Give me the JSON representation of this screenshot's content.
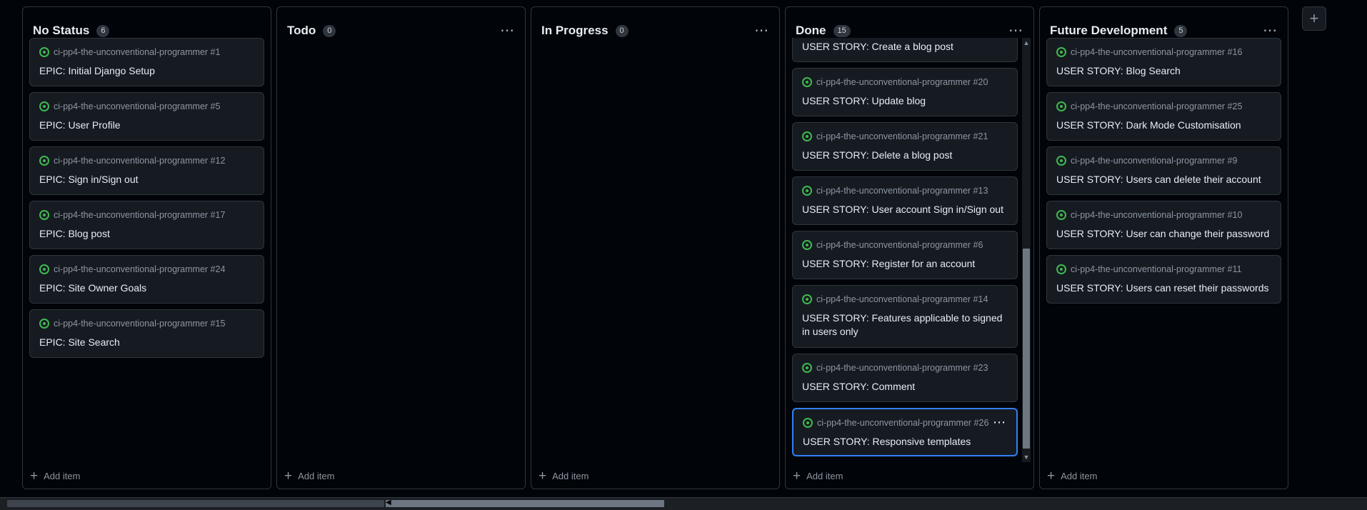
{
  "columns": [
    {
      "title": "No Status",
      "count": "6",
      "cards": [
        {
          "meta": "ci-pp4-the-unconventional-programmer #1",
          "title": "EPIC: Initial Django Setup"
        },
        {
          "meta": "ci-pp4-the-unconventional-programmer #5",
          "title": "EPIC: User Profile"
        },
        {
          "meta": "ci-pp4-the-unconventional-programmer #12",
          "title": "EPIC: Sign in/Sign out"
        },
        {
          "meta": "ci-pp4-the-unconventional-programmer #17",
          "title": "EPIC: Blog post"
        },
        {
          "meta": "ci-pp4-the-unconventional-programmer #24",
          "title": "EPIC: Site Owner Goals"
        },
        {
          "meta": "ci-pp4-the-unconventional-programmer #15",
          "title": "EPIC: Site Search"
        }
      ],
      "add_label": "Add item"
    },
    {
      "title": "Todo",
      "count": "0",
      "cards": [],
      "add_label": "Add item"
    },
    {
      "title": "In Progress",
      "count": "0",
      "cards": [],
      "add_label": "Add item"
    },
    {
      "title": "Done",
      "count": "15",
      "cards": [
        {
          "meta": "",
          "title": "USER STORY: Create a blog post"
        },
        {
          "meta": "ci-pp4-the-unconventional-programmer #20",
          "title": "USER STORY: Update blog"
        },
        {
          "meta": "ci-pp4-the-unconventional-programmer #21",
          "title": "USER STORY: Delete a blog post"
        },
        {
          "meta": "ci-pp4-the-unconventional-programmer #13",
          "title": "USER STORY: User account Sign in/Sign out"
        },
        {
          "meta": "ci-pp4-the-unconventional-programmer #6",
          "title": "USER STORY: Register for an account"
        },
        {
          "meta": "ci-pp4-the-unconventional-programmer #14",
          "title": "USER STORY: Features applicable to signed in users only"
        },
        {
          "meta": "ci-pp4-the-unconventional-programmer #23",
          "title": "USER STORY: Comment"
        },
        {
          "meta": "ci-pp4-the-unconventional-programmer #26",
          "title": "USER STORY: Responsive templates"
        }
      ],
      "add_label": "Add item"
    },
    {
      "title": "Future Development",
      "count": "5",
      "cards": [
        {
          "meta": "ci-pp4-the-unconventional-programmer #16",
          "title": "USER STORY: Blog Search"
        },
        {
          "meta": "ci-pp4-the-unconventional-programmer #25",
          "title": "USER STORY: Dark Mode Customisation"
        },
        {
          "meta": "ci-pp4-the-unconventional-programmer #9",
          "title": "USER STORY: Users can delete their account"
        },
        {
          "meta": "ci-pp4-the-unconventional-programmer #10",
          "title": "USER STORY: User can change their password"
        },
        {
          "meta": "ci-pp4-the-unconventional-programmer #11",
          "title": "USER STORY: Users can reset their passwords"
        }
      ],
      "add_label": "Add item"
    }
  ],
  "icons": {
    "menu": "⋯",
    "plus": "+",
    "open_issue": "open-issue-icon"
  },
  "colors": {
    "background": "#010409",
    "card": "#161b22",
    "border": "#30363d",
    "open_issue": "#3fb950",
    "selected_border": "#2f81f7"
  }
}
